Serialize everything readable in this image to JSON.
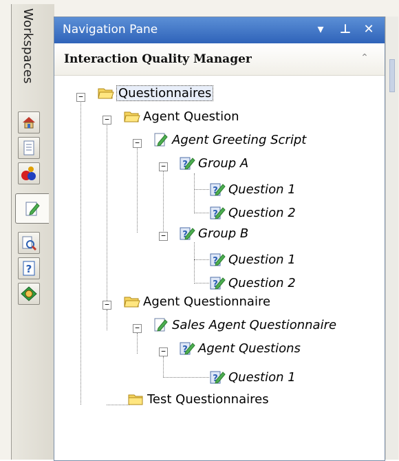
{
  "workspaces": {
    "label": "Workspaces",
    "buttons": [
      {
        "icon": "home-icon"
      },
      {
        "icon": "document-list-icon"
      },
      {
        "icon": "users-icon"
      },
      {
        "icon": "questionnaire-icon",
        "active": true
      },
      {
        "icon": "search-document-icon"
      },
      {
        "icon": "help-icon"
      },
      {
        "icon": "globe-icon"
      }
    ]
  },
  "pane": {
    "title": "Navigation Pane",
    "dropdown_glyph": "▾",
    "pin_glyph": "⊥",
    "close_glyph": "✕",
    "section_title": "Interaction Quality Manager",
    "collapse_glyph": "⌃"
  },
  "tree": {
    "root": "Questionnaires",
    "folders": [
      {
        "label": "Agent Question",
        "questionnaire": "Agent Greeting Script",
        "groups": [
          {
            "label": "Group A",
            "questions": [
              "Question 1",
              "Question 2"
            ]
          },
          {
            "label": "Group B",
            "questions": [
              "Question 1",
              "Question 2"
            ]
          }
        ]
      },
      {
        "label": "Agent Questionnaire",
        "questionnaire": "Sales Agent Questionnaire",
        "groups": [
          {
            "label": "Agent Questions",
            "questions": [
              "Question 1"
            ]
          }
        ]
      },
      {
        "label": "Test Questionnaires"
      }
    ]
  },
  "colors": {
    "title_bar": "#2f63b9",
    "folder": "#f4d35e",
    "selection": "#e8eef9"
  }
}
